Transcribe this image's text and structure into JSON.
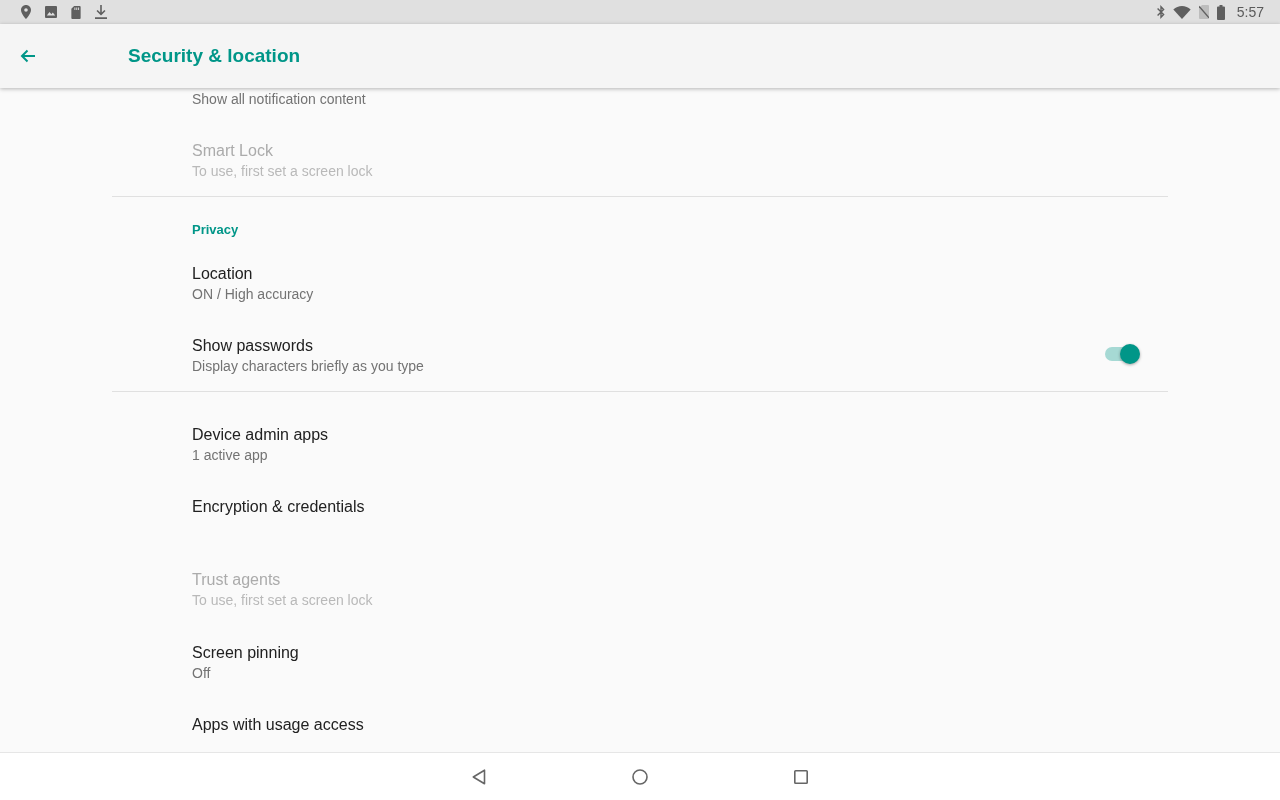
{
  "status_bar": {
    "time": "5:57"
  },
  "app_bar": {
    "title": "Security & location"
  },
  "sections": [
    {
      "items": [
        {
          "kind": "plain",
          "summary": "Show all notification content",
          "disabled": false
        },
        {
          "kind": "plain",
          "title": "Smart Lock",
          "summary": "To use, first set a screen lock",
          "disabled": true
        }
      ]
    },
    {
      "header": "Privacy",
      "items": [
        {
          "kind": "plain",
          "title": "Location",
          "summary": "ON / High accuracy",
          "disabled": false
        },
        {
          "kind": "switch",
          "title": "Show passwords",
          "summary": "Display characters briefly as you type",
          "disabled": false,
          "on": true
        }
      ]
    },
    {
      "items": [
        {
          "kind": "plain",
          "title": "Device admin apps",
          "summary": "1 active app",
          "disabled": false
        },
        {
          "kind": "plain",
          "title": "Encryption & credentials",
          "disabled": false
        },
        {
          "kind": "plain",
          "title": "Trust agents",
          "summary": "To use, first set a screen lock",
          "disabled": true
        },
        {
          "kind": "plain",
          "title": "Screen pinning",
          "summary": "Off",
          "disabled": false
        },
        {
          "kind": "plain",
          "title": "Apps with usage access",
          "disabled": false
        }
      ]
    }
  ]
}
